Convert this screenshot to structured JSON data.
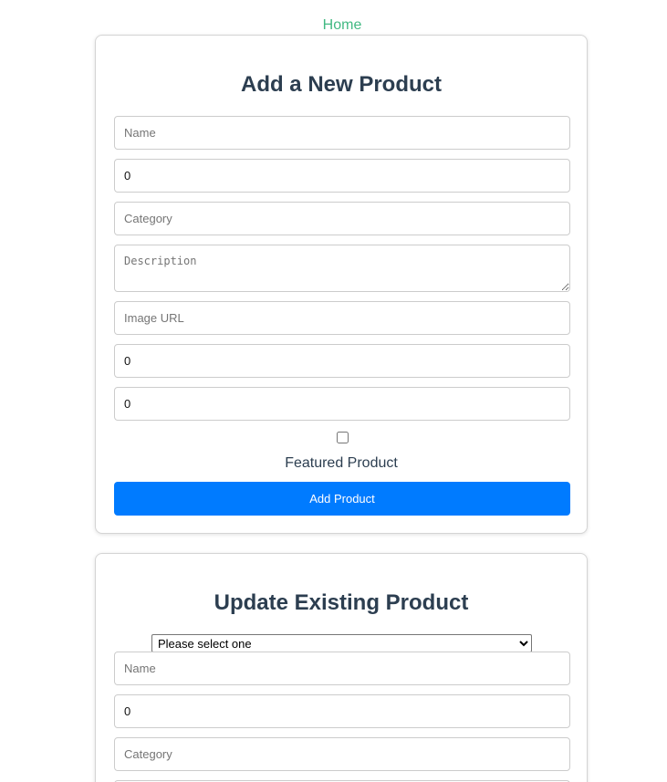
{
  "nav": {
    "home_label": "Home"
  },
  "add_form": {
    "title": "Add a New Product",
    "name_placeholder": "Name",
    "price_value": "0",
    "category_placeholder": "Category",
    "description_placeholder": "Description",
    "image_url_placeholder": "Image URL",
    "stock_value": "0",
    "rating_value": "0",
    "featured_label": "Featured Product",
    "submit_label": "Add Product"
  },
  "update_form": {
    "title": "Update Existing Product",
    "select_selected": "Please select one",
    "name_placeholder": "Name",
    "price_value": "0",
    "category_placeholder": "Category"
  },
  "colors": {
    "link": "#42b983",
    "heading": "#2c3e50",
    "primary_button": "#007bff"
  }
}
